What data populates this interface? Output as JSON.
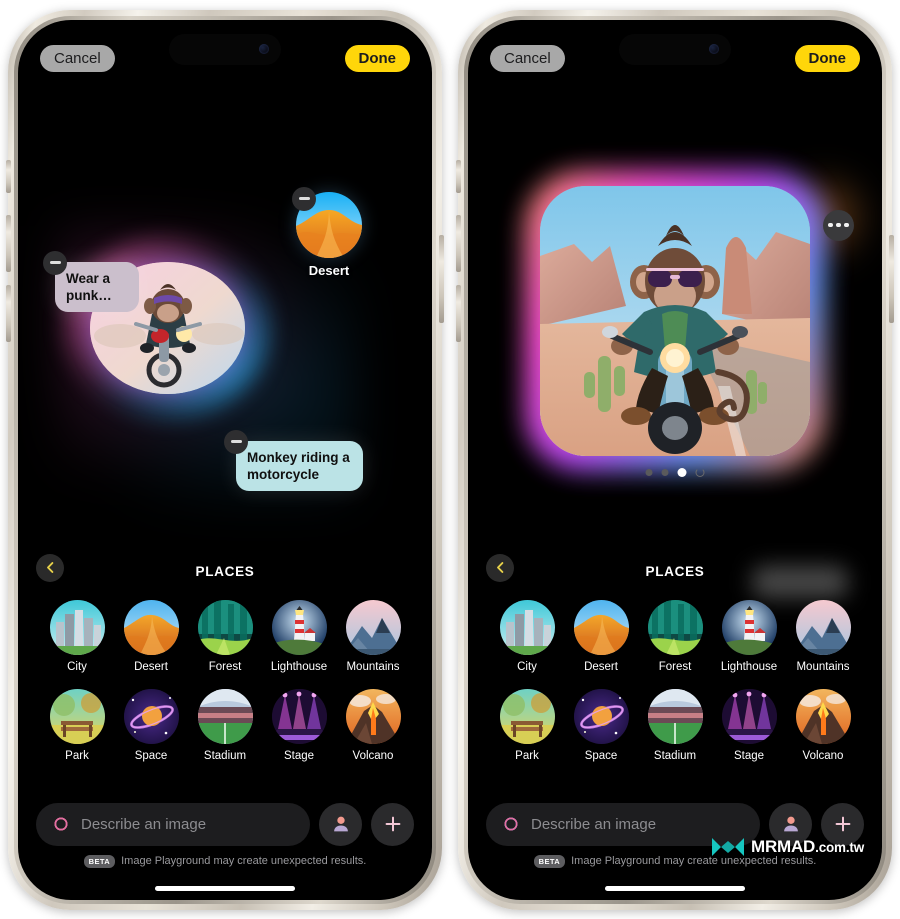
{
  "app": {
    "name": "Image Playground",
    "accent_yellow": "#ffd60a",
    "chip_purple": "#cbbfcc",
    "chip_cyan": "#bbe3e6"
  },
  "topbar": {
    "cancel_label": "Cancel",
    "done_label": "Done"
  },
  "left_phone": {
    "chips": [
      {
        "id": "punk",
        "label": "Wear a punk…",
        "type": "text-chip",
        "color": "#cbbfcc"
      },
      {
        "id": "motorcycle",
        "label": "Monkey riding a motorcycle",
        "type": "text-chip",
        "color": "#bbe3e6"
      }
    ],
    "concept": {
      "label": "Desert",
      "type": "thumbnail-chip"
    },
    "preview_alt": "Monkey riding a motorcycle"
  },
  "right_phone": {
    "hero_alt": "Monkey with sunglasses riding a motorcycle in the desert",
    "more_label": "More options",
    "page_dots": {
      "count": 4,
      "active_index": 2,
      "loading_index": 3
    }
  },
  "picker": {
    "title": "PLACES",
    "back_label": "Back",
    "items": [
      {
        "label": "City",
        "icon": "city-thumbnail"
      },
      {
        "label": "Desert",
        "icon": "desert-thumbnail"
      },
      {
        "label": "Forest",
        "icon": "forest-thumbnail"
      },
      {
        "label": "Lighthouse",
        "icon": "lighthouse-thumbnail"
      },
      {
        "label": "Mountains",
        "icon": "mountains-thumbnail"
      },
      {
        "label": "Park",
        "icon": "park-thumbnail"
      },
      {
        "label": "Space",
        "icon": "space-thumbnail"
      },
      {
        "label": "Stadium",
        "icon": "stadium-thumbnail"
      },
      {
        "label": "Stage",
        "icon": "stage-thumbnail"
      },
      {
        "label": "Volcano",
        "icon": "volcano-thumbnail"
      }
    ]
  },
  "input": {
    "placeholder": "Describe an image",
    "value": "",
    "sparkle_icon": "apple-intelligence-icon",
    "person_icon": "person-icon",
    "add_icon": "plus-icon"
  },
  "disclaimer": {
    "badge": "BETA",
    "text": "Image Playground may create unexpected results."
  },
  "watermark": {
    "brand": "MRMAD",
    "suffix": ".com.tw",
    "logo_color": "#16c6c0"
  }
}
